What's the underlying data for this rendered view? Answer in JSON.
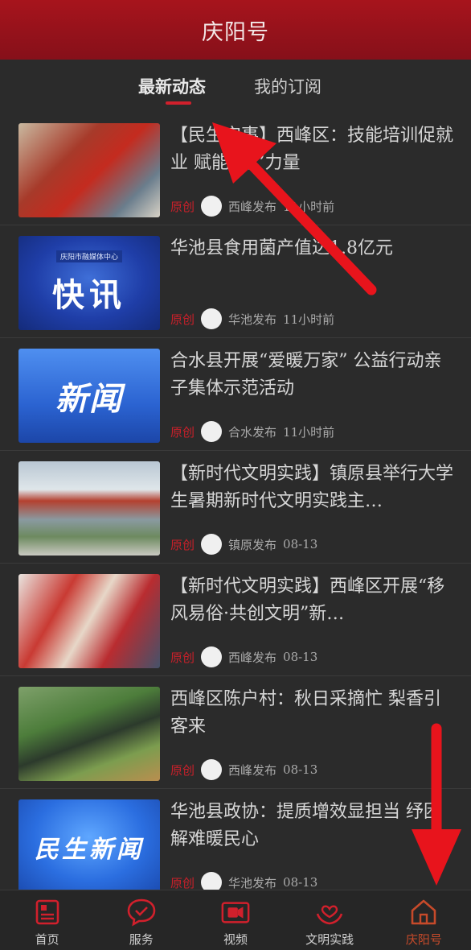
{
  "header": {
    "title": "庆阳号"
  },
  "tabs": [
    {
      "label": "最新动态",
      "active": true
    },
    {
      "label": "我的订阅",
      "active": false
    }
  ],
  "feed": [
    {
      "title": "【民生实事】西峰区：技能培训促就业 赋能“她”力量",
      "tag": "原创",
      "source": "西峰发布",
      "time": "11小时前"
    },
    {
      "title": "华池县食用菌产值达1.8亿元",
      "tag": "原创",
      "source": "华池发布",
      "time": "11小时前",
      "thumb_sub": "庆阳市融媒体中心",
      "thumb_text": "快讯"
    },
    {
      "title": "合水县开展“爱暖万家” 公益行动亲子集体示范活动",
      "tag": "原创",
      "source": "合水发布",
      "time": "11小时前",
      "thumb_text": "新闻"
    },
    {
      "title": "【新时代文明实践】镇原县举行大学生暑期新时代文明实践主…",
      "tag": "原创",
      "source": "镇原发布",
      "time": "08-13"
    },
    {
      "title": "【新时代文明实践】西峰区开展“移风易俗·共创文明”新…",
      "tag": "原创",
      "source": "西峰发布",
      "time": "08-13"
    },
    {
      "title": "西峰区陈户村：秋日采摘忙 梨香引客来",
      "tag": "原创",
      "source": "西峰发布",
      "time": "08-13"
    },
    {
      "title": "华池县政协：提质增效显担当 纾困解难暖民心",
      "tag": "原创",
      "source": "华池发布",
      "time": "08-13",
      "thumb_text": "民生新闻"
    }
  ],
  "bottom_nav": [
    {
      "label": "首页",
      "icon": "newspaper-icon",
      "active": false
    },
    {
      "label": "服务",
      "icon": "chat-check-icon",
      "active": false
    },
    {
      "label": "视频",
      "icon": "video-icon",
      "active": false
    },
    {
      "label": "文明实践",
      "icon": "heart-hands-icon",
      "active": false
    },
    {
      "label": "庆阳号",
      "icon": "home-icon",
      "active": true
    }
  ],
  "colors": {
    "accent": "#d1202c",
    "header_bg": "#a7141c",
    "active_nav": "#c64a2a",
    "bg": "#2b2b2b",
    "annotation_arrow": "#e8141c"
  }
}
